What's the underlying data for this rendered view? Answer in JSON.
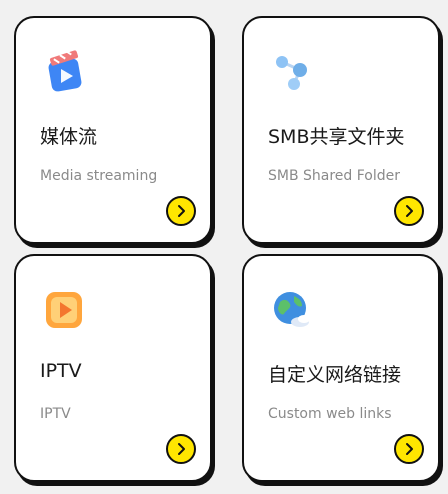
{
  "cards": [
    {
      "icon": "media-streaming-icon",
      "title": "媒体流",
      "subtitle": "Media streaming",
      "action_icon": "chevron-right-icon"
    },
    {
      "icon": "smb-shared-folder-icon",
      "title": "SMB共享文件夹",
      "subtitle": "SMB Shared Folder",
      "action_icon": "chevron-right-icon"
    },
    {
      "icon": "iptv-icon",
      "title": "IPTV",
      "subtitle": "IPTV",
      "action_icon": "chevron-right-icon"
    },
    {
      "icon": "globe-icon",
      "title": "自定义网络链接",
      "subtitle": "Custom web links",
      "action_icon": "chevron-right-icon"
    }
  ],
  "colors": {
    "background": "#f1f1f1",
    "card": "#ffffff",
    "border": "#111111",
    "action_button": "#ffe600",
    "subtitle_text": "#8a8a8a"
  }
}
